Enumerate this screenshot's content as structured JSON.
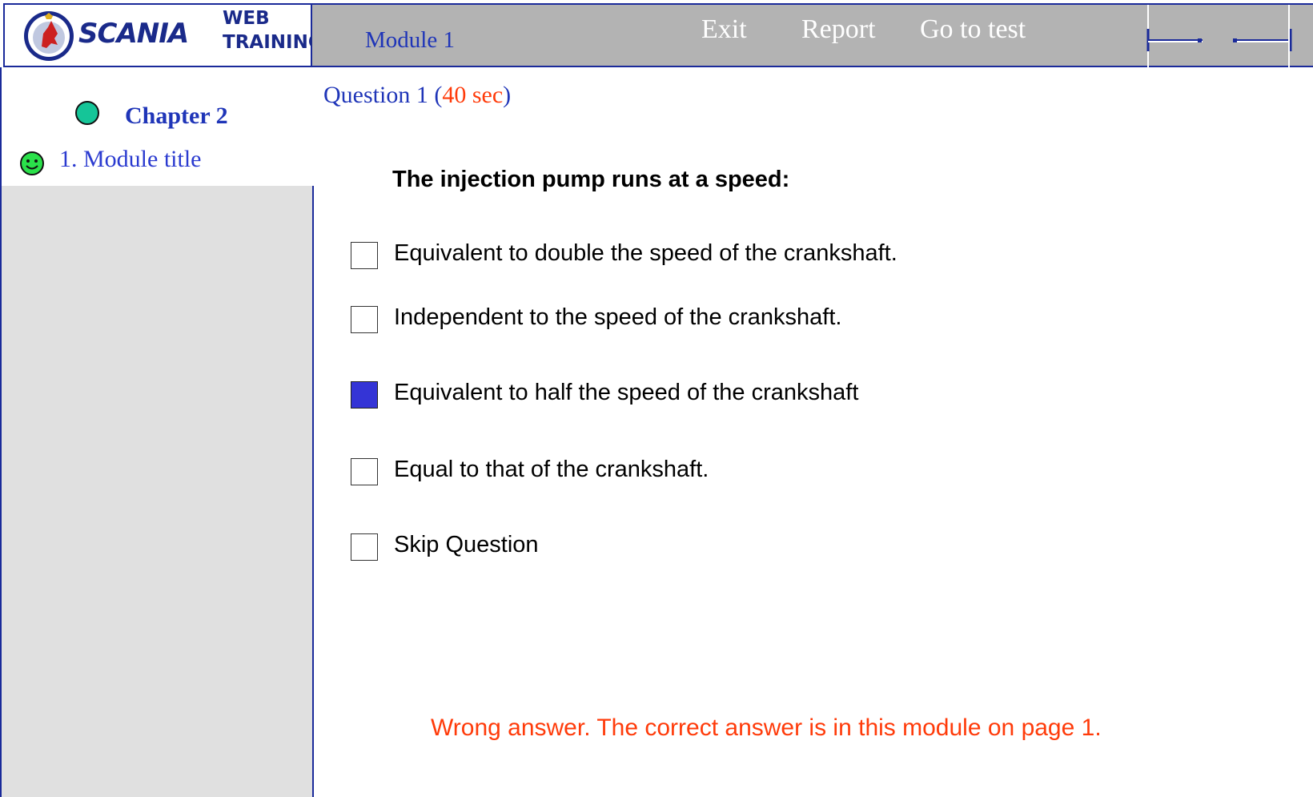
{
  "branding": {
    "logo_icon": "scania-griffin-icon",
    "brand_name": "SCANIA",
    "brand_sub_top": "WEB",
    "brand_sub_bottom": "TRAINING",
    "brand_color": "#1a2a8a"
  },
  "header": {
    "module_title": "Module 1",
    "nav": {
      "exit": "Exit",
      "report": "Report",
      "go_to_test": "Go to test"
    },
    "arrow_icons": [
      "back-arrow-icon",
      "forward-arrow-icon"
    ]
  },
  "sidebar": {
    "chapter_icon": "green-dot-icon",
    "chapter_label": "Chapter 2",
    "module_icon": "smiley-icon",
    "module_link": "1. Module title"
  },
  "question": {
    "label": "Question 1",
    "timer_open": "(",
    "timer_value": "40",
    "timer_unit": "sec",
    "timer_close": ")",
    "prompt": "The injection pump runs at a speed:",
    "answers": [
      {
        "text": "Equivalent to double the speed of the crankshaft.",
        "checked": false
      },
      {
        "text": "Independent to the speed of the crankshaft.",
        "checked": false
      },
      {
        "text": "Equivalent to half the speed of the crankshaft",
        "checked": true
      },
      {
        "text": "Equal to that of the crankshaft.",
        "checked": false
      },
      {
        "text": "Skip Question",
        "checked": false
      }
    ]
  },
  "feedback": {
    "text": "Wrong answer. The correct answer is in this module on page 1."
  },
  "colors": {
    "topbar": "#b3b3b3",
    "sidebar": "#e0e0e0",
    "accent_blue": "#1f35b8",
    "checked_box": "#3434d6",
    "alert_red": "#ff3b0a",
    "chapter_dot": "#15c598"
  }
}
